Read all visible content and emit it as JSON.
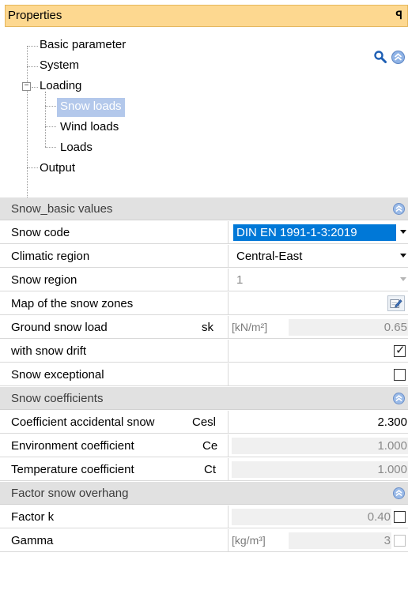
{
  "panel": {
    "title": "Properties",
    "pin_glyph": "ꟼ"
  },
  "tree": {
    "items": [
      {
        "label": "Basic parameter"
      },
      {
        "label": "System"
      },
      {
        "label": "Loading",
        "expander": "−"
      },
      {
        "label": "Snow loads",
        "selected": true
      },
      {
        "label": "Wind loads"
      },
      {
        "label": "Loads"
      },
      {
        "label": "Output"
      }
    ]
  },
  "toolbar": {
    "search_icon": "search-icon",
    "collapse_icon": "collapse-all-icon"
  },
  "sections": [
    {
      "title": "Snow_basic values",
      "rows": [
        {
          "label": "Snow code",
          "value": "DIN EN 1991-1-3:2019"
        },
        {
          "label": "Climatic region",
          "value": "Central-East"
        },
        {
          "label": "Snow region",
          "value": "1"
        },
        {
          "label": "Map of the snow zones"
        },
        {
          "label": "Ground snow load",
          "symbol": "sk",
          "unit": "[kN/m²]",
          "value": "0.65"
        },
        {
          "label": "with snow drift",
          "checked": true
        },
        {
          "label": "Snow exceptional",
          "checked": false
        }
      ]
    },
    {
      "title": "Snow coefficients",
      "rows": [
        {
          "label": "Coefficient accidental snow",
          "symbol": "Cesl",
          "value": "2.300"
        },
        {
          "label": "Environment coefficient",
          "symbol": "Ce",
          "value": "1.000"
        },
        {
          "label": "Temperature coefficient",
          "symbol": "Ct",
          "value": "1.000"
        }
      ]
    },
    {
      "title": "Factor snow overhang",
      "rows": [
        {
          "label": "Factor k",
          "value": "0.40"
        },
        {
          "label": "Gamma",
          "unit": "[kg/m³]",
          "value": "3"
        }
      ]
    }
  ],
  "colors": {
    "header_bg": "#fdd890",
    "selection": "#b3c8eb",
    "field_highlight": "#0078d7",
    "section_bg": "#e1e1e1"
  }
}
